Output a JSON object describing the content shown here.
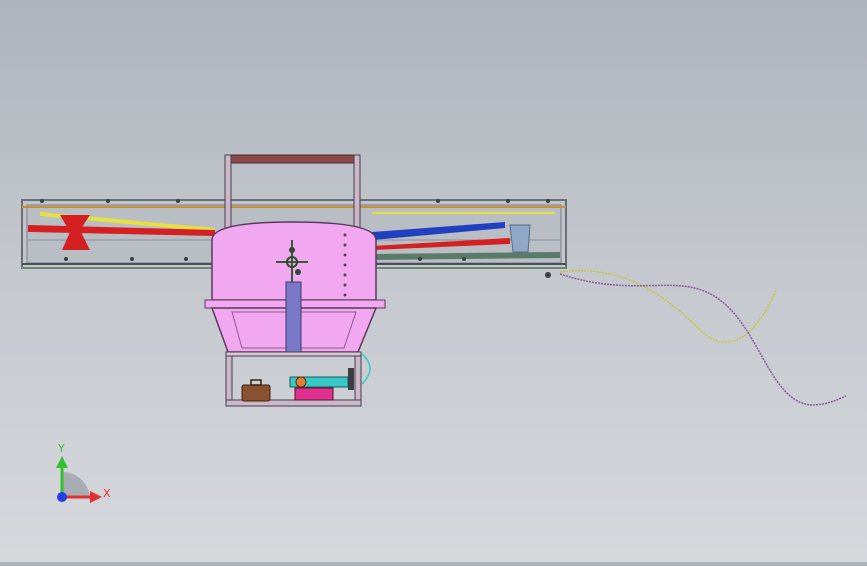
{
  "viewport": {
    "background_top": "#aeb4bd",
    "background_bottom": "#d6d8dc"
  },
  "model": {
    "frame_color": "#8a8f98",
    "vessel_color": "#f2a8f0",
    "handle_color": "#8b4a4a",
    "beam_red": "#d42020",
    "beam_blue": "#2040c0",
    "beam_yellow": "#e8e040",
    "cylinder_color": "#7a78c8",
    "pump_color": "#38c8c8",
    "base_color": "#e03090",
    "case_color": "#8b5030",
    "cable_yellow": "#c8c440",
    "cable_purple": "#8a5a9a"
  },
  "triad": {
    "x_label": "X",
    "y_label": "Y",
    "x_color": "#e03030",
    "y_color": "#30c030",
    "z_color": "#2040e0"
  }
}
